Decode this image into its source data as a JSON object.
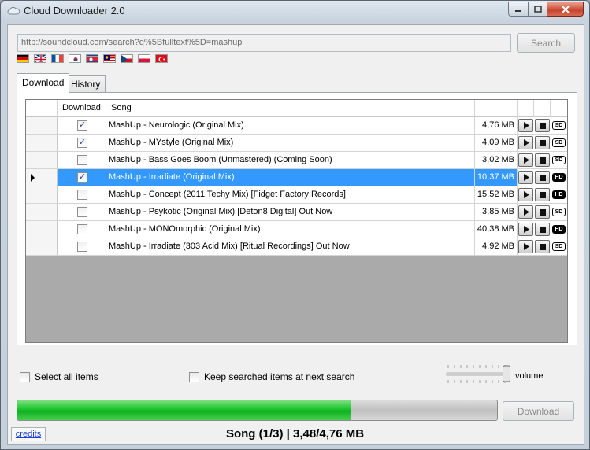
{
  "window": {
    "title": "Cloud Downloader 2.0"
  },
  "search": {
    "url": "http://soundcloud.com/search?q%5Bfulltext%5D=mashup",
    "button_label": "Search"
  },
  "flags": [
    "german-flag",
    "uk-flag",
    "french-flag",
    "korean-flag",
    "north-korean-flag",
    "malaysian-flag",
    "czech-flag",
    "polish-flag",
    "turkish-flag"
  ],
  "tabs": [
    {
      "label": "Download",
      "active": true
    },
    {
      "label": "History",
      "active": false
    }
  ],
  "grid": {
    "headers": {
      "download": "Download",
      "song": "Song"
    },
    "rows": [
      {
        "checked": true,
        "song": "MashUp - Neurologic (Original Mix)",
        "size": "4,76 MB",
        "quality": "SD",
        "selected": false
      },
      {
        "checked": true,
        "song": "MashUp - MYstyle (Original Mix)",
        "size": "4,09 MB",
        "quality": "SD",
        "selected": false
      },
      {
        "checked": false,
        "song": "MashUp - Bass Goes Boom (Unmastered) (Coming Soon)",
        "size": "3,02 MB",
        "quality": "SD",
        "selected": false
      },
      {
        "checked": true,
        "song": "MashUp - Irradiate (Original Mix)",
        "size": "10,37 MB",
        "quality": "HD",
        "selected": true
      },
      {
        "checked": false,
        "song": "MashUp - Concept (2011 Techy Mix) [Fidget Factory Records]",
        "size": "15,52 MB",
        "quality": "HD",
        "selected": false
      },
      {
        "checked": false,
        "song": "MashUp - Psykotic (Original Mix) [Deton8 Digital] Out Now",
        "size": "3,85 MB",
        "quality": "SD",
        "selected": false
      },
      {
        "checked": false,
        "song": "MashUp - MONOmorphic (Original Mix)",
        "size": "40,38 MB",
        "quality": "HD",
        "selected": false
      },
      {
        "checked": false,
        "song": "MashUp - Irradiate (303 Acid Mix) [Ritual Recordings] Out Now",
        "size": "4,92 MB",
        "quality": "SD",
        "selected": false
      }
    ]
  },
  "options": {
    "select_all_label": "Select all items",
    "keep_searched_label": "Keep searched items at next search",
    "volume_label": "volume",
    "volume_level": 0.95
  },
  "progress": {
    "fraction": 0.694
  },
  "footer": {
    "download_button": "Download",
    "credits_label": "credits",
    "status": "Song (1/3) | 3,48/4,76 MB"
  },
  "colors": {
    "selection": "#3399ff",
    "progress": "#18c42c"
  }
}
